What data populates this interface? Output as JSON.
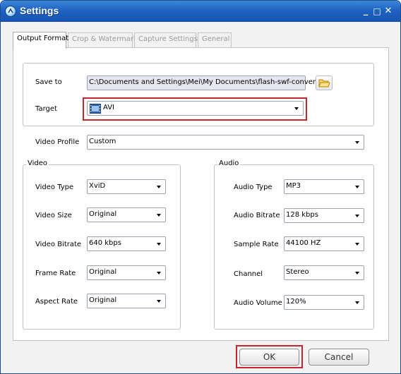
{
  "window": {
    "title": "Settings",
    "minimize": "_",
    "maximize": "□",
    "close": "✕"
  },
  "tabs": [
    {
      "label": "Output Format",
      "active": true
    },
    {
      "label": "Crop & Watermark",
      "active": false
    },
    {
      "label": "Capture Settings",
      "active": false
    },
    {
      "label": "General",
      "active": false
    }
  ],
  "output": {
    "save_to_label": "Save to",
    "save_to_value": "C:\\Documents and Settings\\Mei\\My Documents\\flash-swf-convert",
    "target_label": "Target",
    "target_value": "AVI",
    "video_profile_label": "Video Profile",
    "video_profile_value": "Custom"
  },
  "video": {
    "legend": "Video",
    "rows": [
      {
        "label": "Video Type",
        "value": "XviD"
      },
      {
        "label": "Video Size",
        "value": "Original"
      },
      {
        "label": "Video Bitrate",
        "value": "640 kbps"
      },
      {
        "label": "Frame Rate",
        "value": "Original"
      },
      {
        "label": "Aspect Rate",
        "value": "Original"
      }
    ]
  },
  "audio": {
    "legend": "Audio",
    "rows": [
      {
        "label": "Audio Type",
        "value": "MP3"
      },
      {
        "label": "Audio Bitrate",
        "value": "128 kbps"
      },
      {
        "label": "Sample Rate",
        "value": "44100 HZ"
      },
      {
        "label": "Channel",
        "value": "Stereo"
      },
      {
        "label": "Audio Volume",
        "value": "120%"
      }
    ]
  },
  "buttons": {
    "ok": "OK",
    "cancel": "Cancel"
  },
  "colors": {
    "titlebar": "#1f63c3",
    "highlight": "#c8262e"
  },
  "icons": {
    "app": "settings-app-icon",
    "browse": "folder-open-icon",
    "target": "film-icon"
  }
}
